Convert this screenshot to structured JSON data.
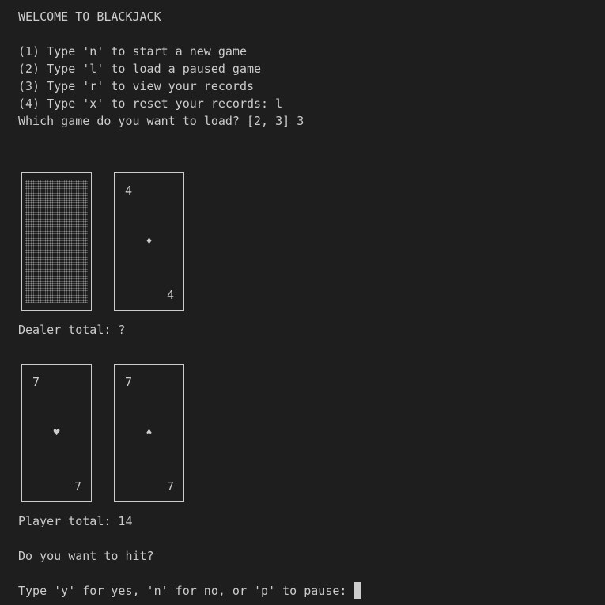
{
  "terminal": {
    "lines": {
      "welcome": "WELCOME TO BLACKJACK",
      "option1": "(1) Type 'n' to start a new game",
      "option2": "(2) Type 'l' to load a paused game",
      "option3": "(3) Type 'r' to view your records",
      "option4": "(4) Type 'x' to reset your records: l",
      "load_prompt": "Which game do you want to load? [2, 3] 3",
      "dealer_total": "Dealer total: ?",
      "player_total": "Player total: 14",
      "hit_question": "Do you want to hit?",
      "input_prompt": "Type 'y' for yes, 'n' for no, or 'p' to pause: "
    },
    "dealer_cards": [
      {
        "face_down": true,
        "rank": "",
        "suit": ""
      },
      {
        "face_down": false,
        "rank": "4",
        "suit": "♦",
        "suit_name": "diamond-icon"
      }
    ],
    "player_cards": [
      {
        "face_down": false,
        "rank": "7",
        "suit": "♥",
        "suit_name": "heart-icon"
      },
      {
        "face_down": false,
        "rank": "7",
        "suit": "♠",
        "suit_name": "spade-icon"
      }
    ],
    "colors": {
      "background": "#1e1e1e",
      "foreground": "#cccccc"
    }
  }
}
